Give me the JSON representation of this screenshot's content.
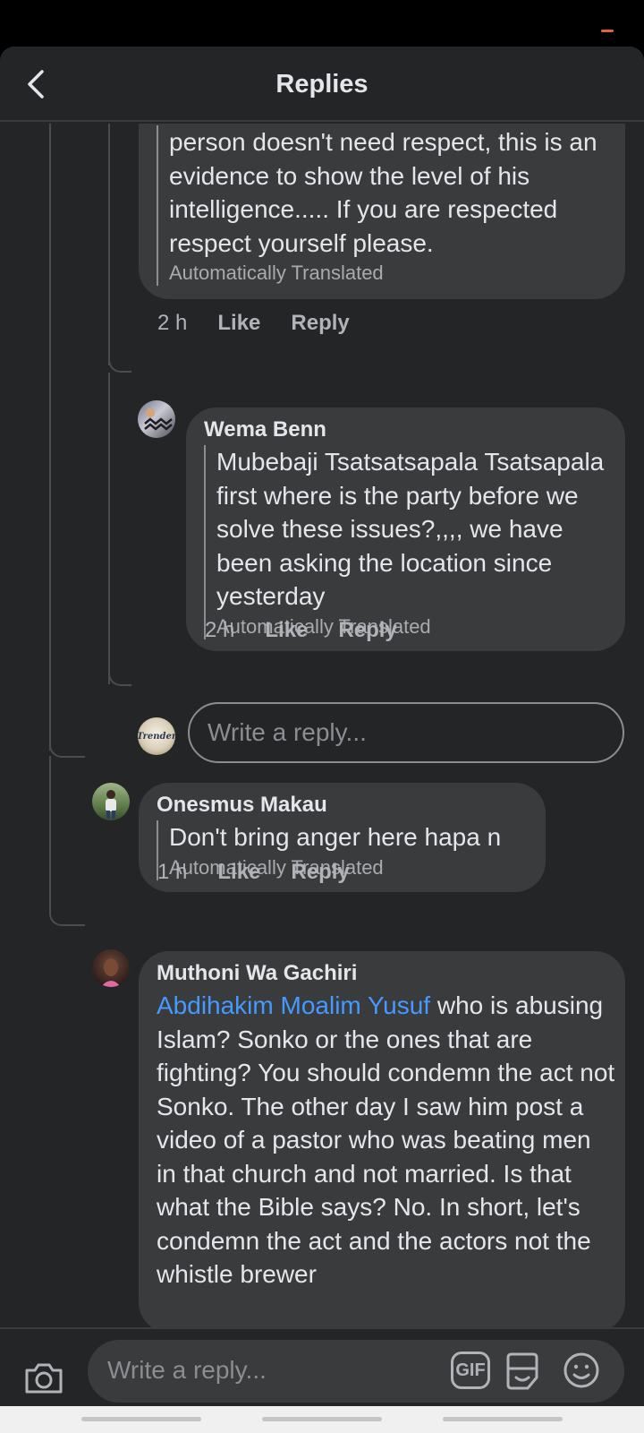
{
  "header": {
    "title": "Replies"
  },
  "comments": [
    {
      "author": "",
      "text": "person doesn't need respect, this is an evidence to show the level of his intelligence..... If you are respected respect yourself please.",
      "auto_translated": "Automatically Translated",
      "time": "2 h",
      "like": "Like",
      "reply": "Reply"
    },
    {
      "author": "Wema Benn",
      "text": "Mubebaji Tsatsatsapala Tsatsapala first where is the party before we solve these issues?,,,, we have been asking the location since yesterday",
      "auto_translated": "Automatically Translated",
      "time": "2 h",
      "like": "Like",
      "reply": "Reply"
    },
    {
      "author": "Onesmus Makau",
      "text": "Don't bring anger here hapa n",
      "auto_translated": "Automatically Translated",
      "time": "1 h",
      "like": "Like",
      "reply": "Reply"
    },
    {
      "author": "Muthoni Wa Gachiri",
      "mention": "Abdihakim Moalim Yusuf",
      "text": " who is abusing Islam? Sonko or the ones that are fighting? You should condemn the act not Sonko. The other day I saw him post a video of a pastor who was beating men in that church and not married. Is that what the Bible says? No. In short, let's condemn the act and the actors not the whistle brewer"
    }
  ],
  "inline_reply": {
    "placeholder": "Write a reply...",
    "avatar_text": "Trender"
  },
  "composer": {
    "placeholder": "Write a reply...",
    "gif_label": "GIF"
  },
  "colors": {
    "background": "#242526",
    "bubble": "#3a3b3c",
    "link": "#4599ff",
    "accent_dash": "#e0643a"
  }
}
